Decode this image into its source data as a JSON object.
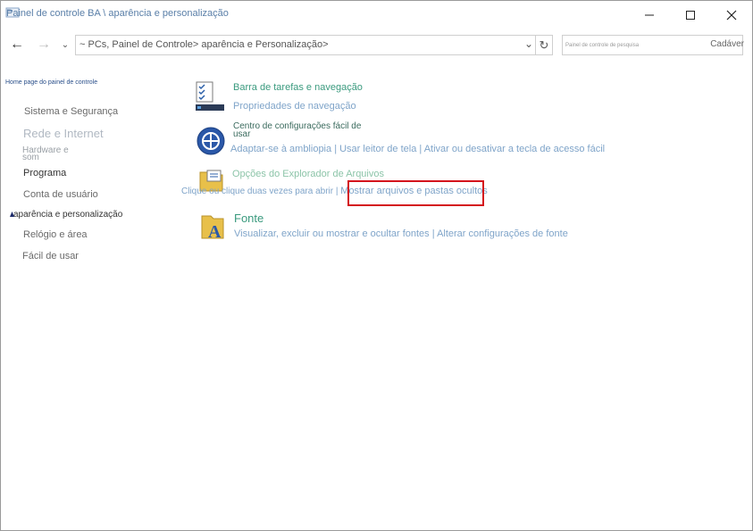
{
  "window": {
    "title": "Painel de controle BA \\ aparência e personalização",
    "controls": {
      "minimize": "minimize",
      "maximize": "maximize",
      "close": "close"
    }
  },
  "navbar": {
    "address": "~ PCs, Painel de Controle> aparência e Personalização>",
    "search_placeholder": "Painel de controle de pesquisa",
    "search_label": "Cadáver"
  },
  "sidebar": {
    "home": "Home page do painel de controle",
    "items": [
      {
        "label": "Sistema e Segurança"
      },
      {
        "label": "Rede e Internet"
      },
      {
        "label": "Hardware e"
      },
      {
        "label": "som"
      },
      {
        "label": "Programa"
      },
      {
        "label": "Conta de usuário"
      },
      {
        "label": "aparência e personalização"
      },
      {
        "label": "Relógio e área"
      },
      {
        "label": "Fácil de usar"
      }
    ]
  },
  "main": {
    "taskbar": {
      "title": "Barra de tarefas e navegação",
      "link": "Propriedades de navegação"
    },
    "ease": {
      "title_line1": "Centro de configurações fácil de",
      "title_line2": "usar",
      "links": [
        "Adaptar-se à ambliopia",
        "Usar leitor de tela",
        "Ativar ou desativar a tecla de acesso fácil"
      ],
      "separator": "|"
    },
    "explorer": {
      "title": "Opções do Explorador de Arquivos",
      "link1": "Clique ou clique duas vezes para abrir",
      "separator": "|",
      "link2": "Mostrar arquivos e pastas ocultos"
    },
    "fonts": {
      "title": "Fonte",
      "link1": "Visualizar, excluir ou mostrar e ocultar fontes",
      "separator": "|",
      "link2": "Alterar configurações de fonte"
    }
  },
  "colors": {
    "category_title": "#3a9a7e",
    "link": "#7fa4c9",
    "highlight": "#d4141c"
  }
}
